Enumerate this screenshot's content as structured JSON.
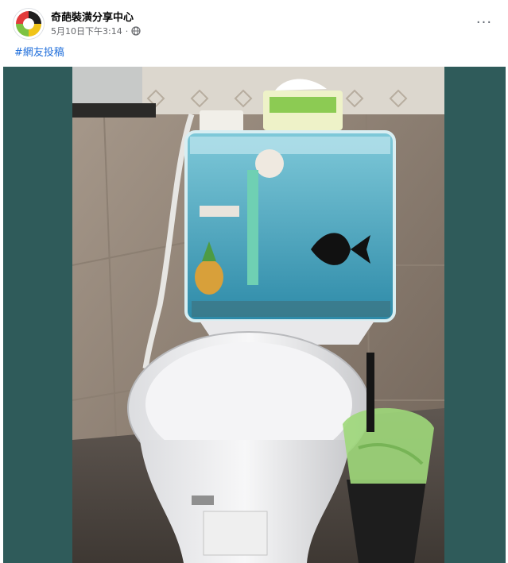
{
  "post": {
    "author": "奇葩裝潢分享中心",
    "date": "5月10日下午3:14",
    "separator": "·",
    "hashtag": "#網友投稿",
    "more_label": "···"
  },
  "colors": {
    "frame": "#2f5b5a",
    "link": "#216fdb",
    "muted": "#65676b"
  },
  "icons": {
    "privacy": "globe-icon",
    "menu": "more-options-icon"
  },
  "photo": {
    "subject": "toilet with transparent fish-tank cistern"
  }
}
